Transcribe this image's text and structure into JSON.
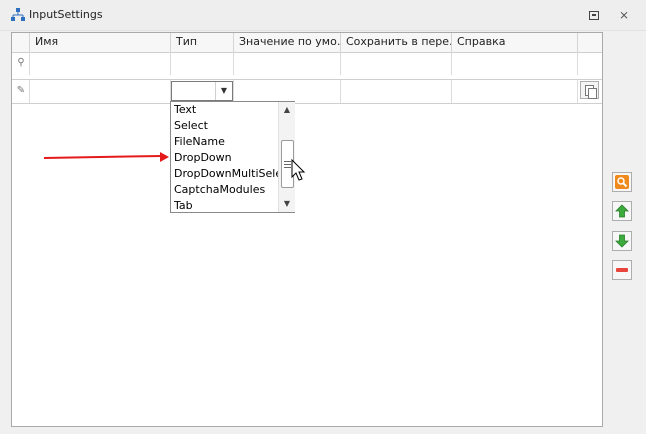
{
  "window": {
    "title": "InputSettings",
    "title_icon": "tree-structure-icon",
    "restore_icon": "restore-window-icon",
    "close_glyph": "⨯"
  },
  "grid": {
    "columns": [
      {
        "label": ""
      },
      {
        "label": "Имя"
      },
      {
        "label": "Тип"
      },
      {
        "label": "Значение по умо…"
      },
      {
        "label": "Сохранить в пере…"
      },
      {
        "label": "Справка"
      },
      {
        "label": ""
      }
    ],
    "filter_row": {
      "indicator_icon": "pin-icon",
      "indicator_glyph": "⚲"
    },
    "new_row": {
      "indicator_icon": "pencil-icon",
      "indicator_glyph": "✎",
      "type_value": ""
    }
  },
  "dropdown": {
    "items": [
      "Text",
      "Select",
      "FileName",
      "DropDown",
      "DropDownMultiSelect",
      "CaptchaModules",
      "Tab"
    ],
    "highlighted_index": 3
  },
  "annotation": {
    "color": "#e41a1a",
    "points_to": "DropDown"
  },
  "side_buttons": [
    {
      "name": "search",
      "icon": "magnifier-icon",
      "color": "#f08a1c"
    },
    {
      "name": "move-up",
      "icon": "arrow-up-icon",
      "color": "#3caa3c"
    },
    {
      "name": "move-down",
      "icon": "arrow-down-icon",
      "color": "#3caa3c"
    },
    {
      "name": "remove",
      "icon": "minus-icon",
      "color": "#e8453c"
    }
  ]
}
